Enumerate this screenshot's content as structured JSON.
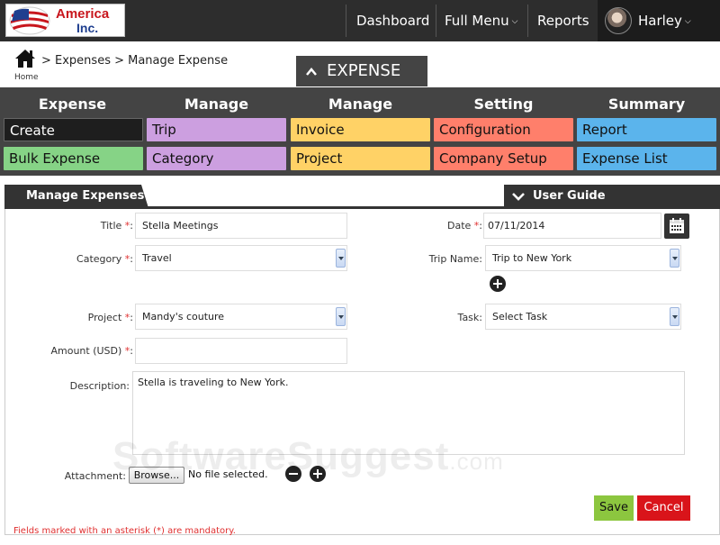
{
  "logo": {
    "line1": "America",
    "line2": "Inc."
  },
  "topnav": {
    "dashboard": "Dashboard",
    "full_menu": "Full Menu",
    "reports": "Reports",
    "user_name": "Harley"
  },
  "breadcrumb": {
    "home_label": "Home",
    "trail": "> Expenses > Manage Expense"
  },
  "section_tab": {
    "label": "EXPENSE"
  },
  "menu": {
    "columns": [
      {
        "title": "Expense",
        "items": [
          "Create",
          "Bulk Expense"
        ],
        "colors": [
          "#1e1e1e",
          "#86d386"
        ]
      },
      {
        "title": "Manage",
        "items": [
          "Trip",
          "Category"
        ],
        "colors": [
          "#cc9fe0",
          "#cc9fe0"
        ]
      },
      {
        "title": "Manage",
        "items": [
          "Invoice",
          "Project"
        ],
        "colors": [
          "#ffd266",
          "#ffd266"
        ]
      },
      {
        "title": "Setting",
        "items": [
          "Configuration",
          "Company Setup"
        ],
        "colors": [
          "#ff7f6b",
          "#ff7f6b"
        ]
      },
      {
        "title": "Summary",
        "items": [
          "Report",
          "Expense List"
        ],
        "colors": [
          "#5bb4ec",
          "#5bb4ec"
        ]
      }
    ]
  },
  "tabs": {
    "manage_expenses": "Manage Expenses",
    "user_guide": "User Guide"
  },
  "form": {
    "title_label": "Title",
    "title_value": "Stella Meetings",
    "date_label": "Date",
    "date_value": "07/11/2014",
    "category_label": "Category",
    "category_value": "Travel",
    "trip_label": "Trip Name:",
    "trip_value": "Trip to New York",
    "project_label": "Project",
    "project_value": "Mandy's couture",
    "task_label": "Task:",
    "task_value": "Select Task",
    "amount_label": "Amount (USD)",
    "amount_value": "",
    "description_label": "Description:",
    "description_value": "Stella is traveling to New York.",
    "attachment_label": "Attachment:",
    "browse_label": "Browse...",
    "file_status": "No file selected.",
    "required_mark": "*",
    "label_suffix": ":"
  },
  "actions": {
    "save": "Save",
    "cancel": "Cancel"
  },
  "footer_note": "Fields marked with an asterisk (*) are mandatory.",
  "watermark": {
    "text": "SoftwareSuggest",
    "suffix": ".com"
  }
}
